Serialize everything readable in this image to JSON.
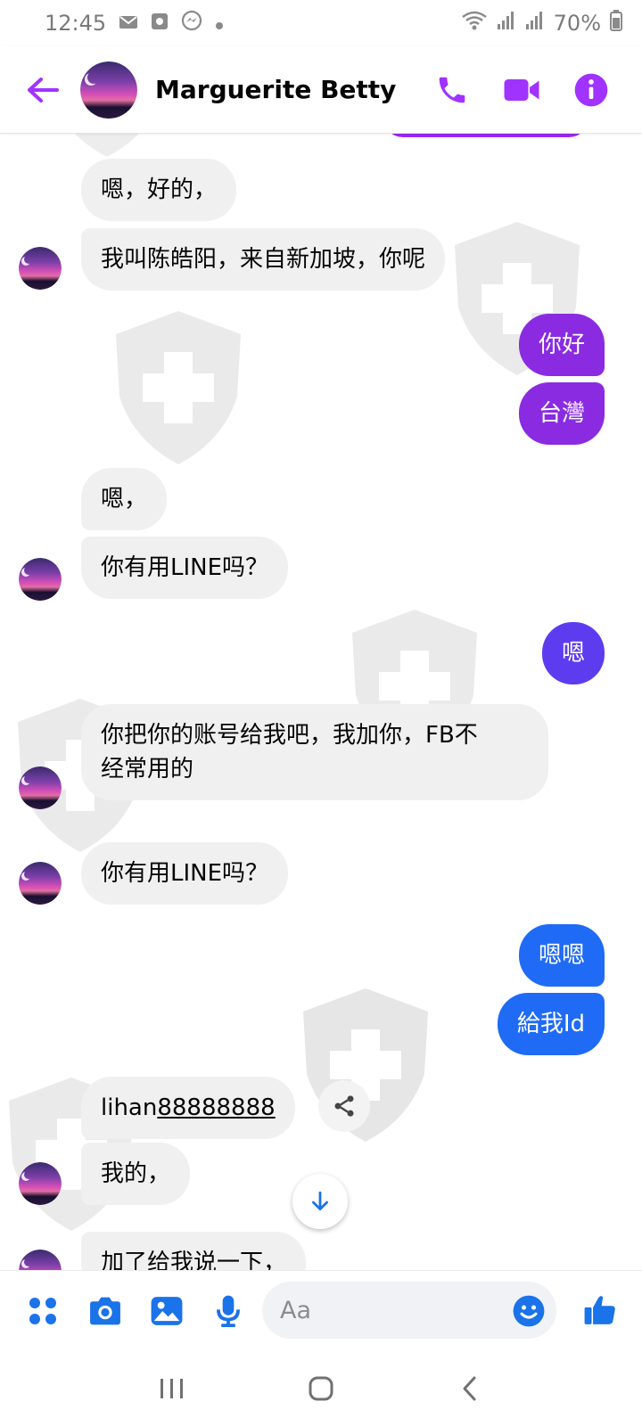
{
  "status_bar": {
    "time": "12:45",
    "battery": "70%",
    "icons": [
      "mail-icon",
      "screenshot-icon",
      "messenger-icon",
      "dot-icon",
      "wifi-icon",
      "signal-icon",
      "battery-icon"
    ]
  },
  "header": {
    "contact_name": "Marguerite Betty",
    "actions": [
      "phone-icon",
      "video-icon",
      "info-icon"
    ],
    "accent_color": "#a033ff"
  },
  "messages": [
    {
      "side": "in",
      "text": "嗯，好的，",
      "avatar": false
    },
    {
      "side": "in",
      "text": "我叫陈皓阳，来自新加坡，你呢",
      "avatar": true
    },
    {
      "side": "out",
      "text": "你好",
      "color": "#8a2be2"
    },
    {
      "side": "out",
      "text": "台灣",
      "color": "#8a2be2"
    },
    {
      "side": "in",
      "text": "嗯，",
      "avatar": false
    },
    {
      "side": "in",
      "text": "你有用LINE吗？",
      "avatar": true
    },
    {
      "side": "out",
      "text": "嗯",
      "color": "#5d3cf0"
    },
    {
      "side": "in",
      "text_line1": "你把你的账号给我吧，我加你，FB不",
      "text_line2": "经常用的",
      "avatar": true
    },
    {
      "side": "in",
      "text": "你有用LINE吗？",
      "avatar": true
    },
    {
      "side": "out",
      "text": "嗯嗯",
      "color": "#1f6bf5"
    },
    {
      "side": "out",
      "text": "給我Id",
      "color": "#1f6bf5"
    },
    {
      "side": "in",
      "text_prefix": "lihan",
      "text_link": "88888888",
      "avatar": false
    },
    {
      "side": "in",
      "text": "我的，",
      "avatar": true
    },
    {
      "side": "in",
      "text": "加了给我说一下，",
      "avatar": true
    }
  ],
  "composer": {
    "placeholder": "Aa",
    "buttons": [
      "apps-icon",
      "camera-icon",
      "gallery-icon",
      "microphone-icon",
      "emoji-icon",
      "thumbs-up-icon"
    ]
  },
  "navbar": {
    "buttons": [
      "recents-icon",
      "home-icon",
      "back-icon"
    ]
  },
  "colors": {
    "incoming_bubble": "#f0f0f0",
    "outgoing_purple": "#8a2be2",
    "outgoing_indigo": "#5d3cf0",
    "outgoing_blue": "#1f6bf5",
    "composer_icon_blue": "#1a73e8"
  }
}
